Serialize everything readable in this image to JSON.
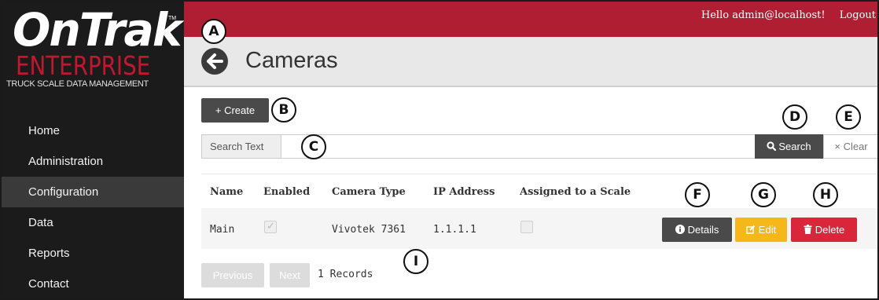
{
  "logo": {
    "main": "OnTrak",
    "tm": "TM",
    "sub": "ENTERPRISE",
    "tagline": "TRUCK SCALE DATA MANAGEMENT"
  },
  "nav": {
    "items": [
      {
        "label": "Home"
      },
      {
        "label": "Administration"
      },
      {
        "label": "Configuration",
        "active": true
      },
      {
        "label": "Data"
      },
      {
        "label": "Reports"
      },
      {
        "label": "Contact"
      }
    ]
  },
  "header": {
    "greeting": "Hello admin@localhost!",
    "logout": "Logout",
    "title": "Cameras"
  },
  "toolbar": {
    "create_label": "+ Create"
  },
  "search": {
    "label": "Search Text",
    "value": "",
    "search_label": "Search",
    "clear_label": "× Clear"
  },
  "table": {
    "columns": [
      "Name",
      "Enabled",
      "Camera Type",
      "IP Address",
      "Assigned to a Scale"
    ],
    "rows": [
      {
        "name": "Main",
        "enabled": true,
        "camera_type": "Vivotek 7361",
        "ip": "1.1.1.1",
        "assigned": false
      }
    ],
    "actions": {
      "details": "Details",
      "edit": "Edit",
      "delete": "Delete"
    }
  },
  "pager": {
    "previous": "Previous",
    "next": "Next",
    "count": "1 Records"
  },
  "markers": {
    "a": "A",
    "b": "B",
    "c": "C",
    "d": "D",
    "e": "E",
    "f": "F",
    "g": "G",
    "h": "H",
    "i": "I"
  },
  "colors": {
    "topbar": "#b01e34",
    "sidebar": "#1b1b1b",
    "edit": "#f5b71a",
    "delete": "#d9263b"
  }
}
